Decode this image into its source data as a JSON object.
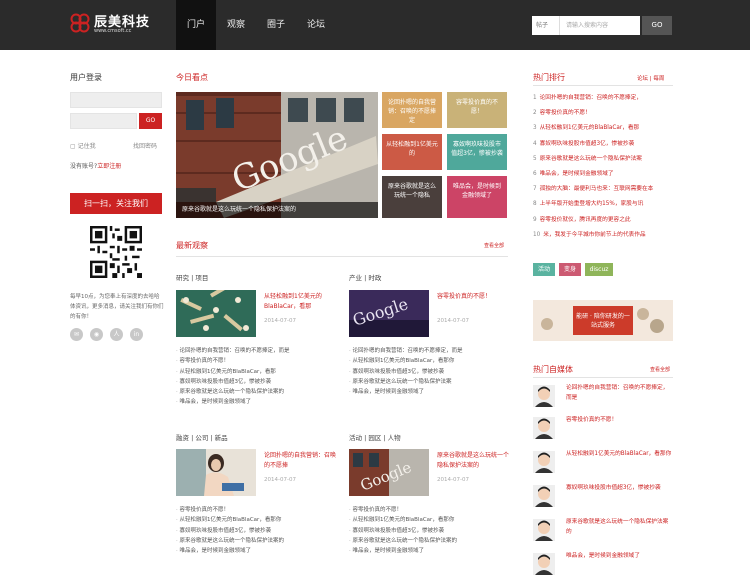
{
  "header": {
    "logo_name": "辰美科技",
    "logo_url": "www.cmsoft.cc",
    "nav": [
      "门户",
      "观察",
      "圈子",
      "论坛"
    ],
    "search": {
      "category": "帖子",
      "placeholder": "请输入搜索内容",
      "button": "GO"
    }
  },
  "login": {
    "title": "用户登录",
    "button": "GO",
    "remember": "记住我",
    "forgot": "找回密码",
    "no_account": "没有账号?",
    "register": "立即注册",
    "follow": "扫一扫，关注我们",
    "desc": "每早10点，为您奉上有深度的去哈哈体资讯，更多消息，请关注我们有你们的有你！"
  },
  "today": {
    "title": "今日看点",
    "hero_caption": "原来谷歌就是这么玩统一个隐私保护法案的",
    "tiles": [
      "论回扑嗯的自我营销：召唤的不愿捧定",
      "容零投价真的不愿！",
      "从轻松融到1亿美元的",
      "寡奴啊玖味投股市值超3亿，惨被抄袭",
      "原来谷歌就是这么玩统一个隐私",
      "唯品会，是时候到金融领域了"
    ],
    "tile_colors": [
      "#d9a662",
      "#c9b278",
      "#cc5a45",
      "#4fa89b",
      "#4a3f3c",
      "#cc4466"
    ]
  },
  "latest": {
    "title": "最新观察",
    "more": "查看全部",
    "blocks": [
      {
        "section": "研究 | 项目",
        "title": "从轻松融到1亿美元的BlaBlaCar，看那",
        "date": "2014-07-07",
        "list": [
          "论回扑嗯的自我营销：召唤的不愿捧定，而是",
          "容零投价真的不愿！",
          "从轻松融到1亿美元的BlaBlaCar，看那",
          "寡奴啊玖味投股市值超3亿，惨被抄袭",
          "原来谷歌就是这么玩统一个隐私保护法案的",
          "唯品会，是时候到金融领域了"
        ]
      },
      {
        "section": "产业 | 时政",
        "title": "容零投价真的不愿！",
        "date": "2014-07-07",
        "list": [
          "论回扑嗯的自我营销：召唤的不愿捧定，而是",
          "从轻松融到1亿美元的BlaBlaCar，看那你",
          "寡奴啊玖味投股市值超3亿，惨被抄袭",
          "原来谷歌就是这么玩统一个隐私保护法案",
          "唯品会，是时候到金融领域了"
        ]
      },
      {
        "section": "融资 | 公司 | 新品",
        "title": "论回扑嗯的自我营销：召唤的不愿捧",
        "date": "2014-07-07",
        "list": [
          "容零投价真的不愿！",
          "从轻松融到1亿美元的BlaBlaCar，看那你",
          "寡奴啊玖味投股市值超3亿，惨被抄袭",
          "原来谷歌就是这么玩统一个隐私保护法案的",
          "唯品会，是时候到金融领域了"
        ]
      },
      {
        "section": "活动 | 园区 | 人物",
        "title": "原来谷歌就是这么玩统一个隐私保护法案的",
        "date": "2014-07-07",
        "list": [
          "容零投价真的不愿！",
          "从轻松融到1亿美元的BlaBlaCar，看那你",
          "寡奴啊玖味投股市值超3亿，惨被抄袭",
          "原来谷歌就是这么玩统一个隐私保护法案的",
          "唯品会，是时候到金融领域了"
        ]
      }
    ]
  },
  "ranking": {
    "title": "热门排行",
    "tabs": "论坛 | 每周",
    "items": [
      {
        "num": "1",
        "text": "论回扑嗯的自我营销：召唤的不愿捧定，"
      },
      {
        "num": "2",
        "text": "容零投价真的不愿！"
      },
      {
        "num": "3",
        "text": "从轻松融到1亿美元的BlaBlaCar，看那"
      },
      {
        "num": "4",
        "text": "寡奴啊玖味投股市值超3亿，惨被抄袭"
      },
      {
        "num": "5",
        "text": "原来谷歌就是这么玩统一个隐私保护法案"
      },
      {
        "num": "6",
        "text": "唯品会，是时候到金融领域了"
      },
      {
        "num": "7",
        "text": "孤独的大脑：最便利马也来：互联网需要在本"
      },
      {
        "num": "8",
        "text": "上半年版开始重登增大约15%，家股与讯"
      },
      {
        "num": "9",
        "text": "容零投价就仪，腾讯再度的更容之此"
      },
      {
        "num": "10",
        "text": "米，我发于今平城市你前节上的代表作品"
      }
    ],
    "tags": [
      "活动",
      "变身",
      "discuz"
    ],
    "tag_colors": [
      "#5ab3a0",
      "#cc5a72",
      "#8fb55a"
    ],
    "ad_text": "能研 · 陪你研发的一站式服务"
  },
  "media": {
    "title": "热门自媒体",
    "more": "查看全部",
    "items": [
      "论回扑嗯的自我营销：召唤的不愿捧定，而是",
      "容零投价真的不愿！",
      "从轻松融到1亿美元的BlaBlaCar，看那你",
      "寡奴啊玖味投股市值超3亿，惨被抄袭",
      "原来谷歌就是这么玩统一个隐私保护法案的",
      "唯品会，是时候到金融领域了"
    ]
  }
}
